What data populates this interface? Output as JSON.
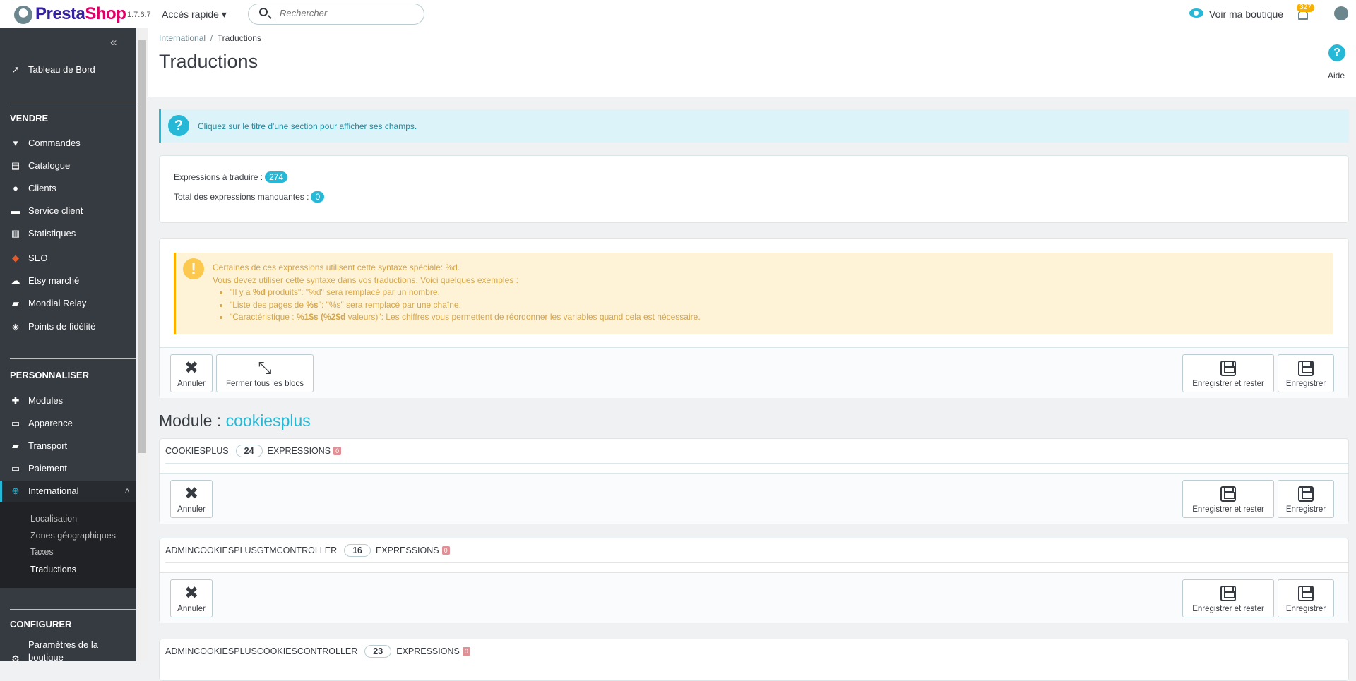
{
  "topbar": {
    "brand_a": "Presta",
    "brand_b": "Shop",
    "version": "1.7.6.7",
    "quick_access": "Accès rapide ▾",
    "search_placeholder": "Rechercher",
    "view_shop": "Voir ma boutique",
    "notifications": "327"
  },
  "sidebar": {
    "collapse": "«",
    "dashboard": "Tableau de Bord",
    "sections": [
      {
        "title": "VENDRE",
        "items": [
          "Commandes",
          "Catalogue",
          "Clients",
          "Service client",
          "Statistiques",
          "SEO",
          "Etsy marché",
          "Mondial Relay",
          "Points de fidélité"
        ]
      },
      {
        "title": "PERSONNALISER",
        "items": [
          "Modules",
          "Apparence",
          "Transport",
          "Paiement",
          "International"
        ]
      },
      {
        "title": "CONFIGURER",
        "items": [
          "Paramètres de la boutique"
        ]
      }
    ],
    "submenu": [
      "Localisation",
      "Zones géographiques",
      "Taxes",
      "Traductions"
    ]
  },
  "header": {
    "breadcrumb_parent": "International",
    "breadcrumb_sep": "/",
    "breadcrumb_current": "Traductions",
    "title": "Traductions",
    "help": "Aide"
  },
  "info": "Cliquez sur le titre d'une section pour afficher ses champs.",
  "stats": {
    "to_translate_label": "Expressions à traduire :",
    "to_translate": "274",
    "missing_label": "Total des expressions manquantes :",
    "missing": "0"
  },
  "warning": {
    "line1": "Certaines de ces expressions utilisent cette syntaxe spéciale: %d.",
    "line2": "Vous devez utiliser cette syntaxe dans vos traductions. Voici quelques exemples :",
    "ex1_a": "\"Il y a ",
    "ex1_b": "%d",
    "ex1_c": " produits\": \"%d\" sera remplacé par un nombre.",
    "ex2_a": "\"Liste des pages de ",
    "ex2_b": "%s",
    "ex2_c": "\": \"%s\" sera remplacé par une chaîne.",
    "ex3_a": "\"Caractéristique : ",
    "ex3_b": "%1$s (%2$d",
    "ex3_c": " valeurs)\": Les chiffres vous permettent de réordonner les variables quand cela est nécessaire."
  },
  "buttons": {
    "cancel": "Annuler",
    "close_all": "Fermer tous les blocs",
    "save_stay": "Enregistrer et rester",
    "save": "Enregistrer"
  },
  "module": {
    "label": "Module :",
    "name": "cookiesplus"
  },
  "sections": [
    {
      "name": "COOKIESPLUS",
      "count": "24",
      "expressions": "EXPRESSIONS",
      "missing": "0"
    },
    {
      "name": "ADMINCOOKIESPLUSGTMCONTROLLER",
      "count": "16",
      "expressions": "EXPRESSIONS",
      "missing": "0"
    },
    {
      "name": "ADMINCOOKIESPLUSCOOKIESCONTROLLER",
      "count": "23",
      "expressions": "EXPRESSIONS",
      "missing": "0"
    }
  ]
}
